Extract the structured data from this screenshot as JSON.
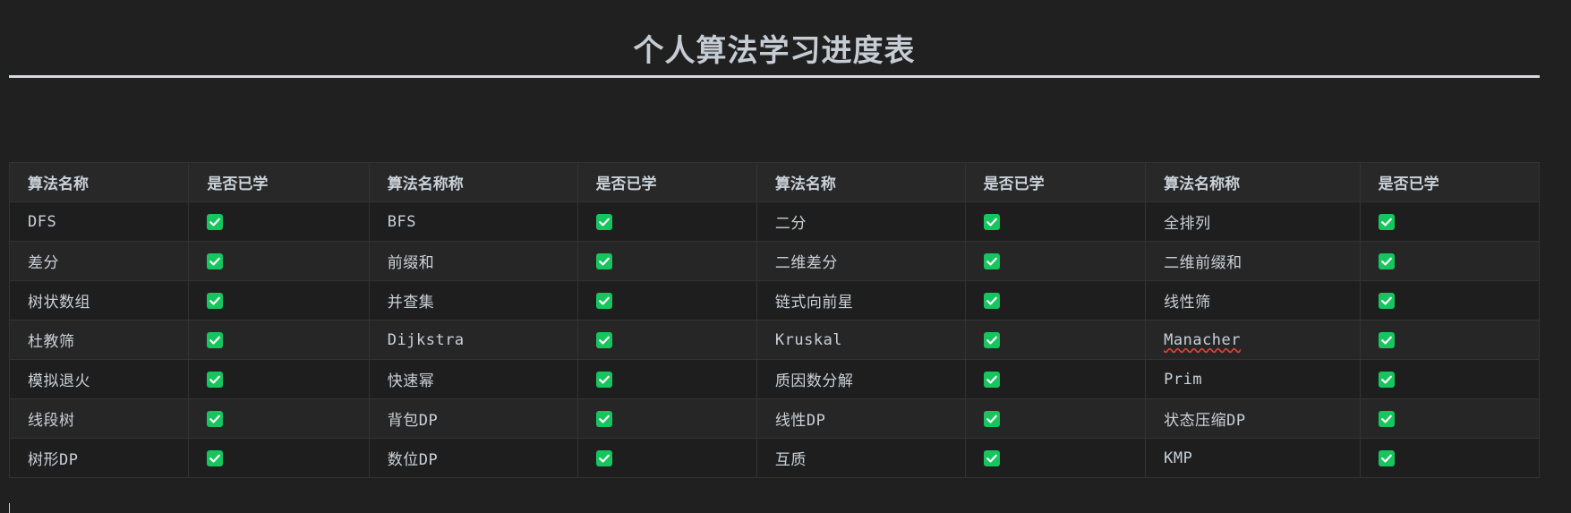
{
  "title": "个人算法学习进度表",
  "accent_colors": {
    "checkbox": "#16c55e",
    "spellcheck_underline": "#e0413a"
  },
  "table": {
    "headers": [
      "算法名称",
      "是否已学",
      "算法名称称",
      "是否已学",
      "算法名称",
      "是否已学",
      "算法名称称",
      "是否已学"
    ],
    "rows": [
      {
        "a1": "DFS",
        "a2": "BFS",
        "a3": "二分",
        "a4": "全排列",
        "checked": [
          true,
          true,
          true,
          true
        ]
      },
      {
        "a1": "差分",
        "a2": "前缀和",
        "a3": "二维差分",
        "a4": "二维前缀和",
        "checked": [
          true,
          true,
          true,
          true
        ]
      },
      {
        "a1": "树状数组",
        "a2": "并查集",
        "a3": "链式向前星",
        "a4": "线性筛",
        "checked": [
          true,
          true,
          true,
          true
        ]
      },
      {
        "a1": "杜教筛",
        "a2": "Dijkstra",
        "a3": "Kruskal",
        "a4": "Manacher",
        "checked": [
          true,
          true,
          true,
          true
        ]
      },
      {
        "a1": "模拟退火",
        "a2": "快速幂",
        "a3": "质因数分解",
        "a4": "Prim",
        "checked": [
          true,
          true,
          true,
          true
        ]
      },
      {
        "a1": "线段树",
        "a2": "背包DP",
        "a3": "线性DP",
        "a4": "状态压缩DP",
        "checked": [
          true,
          true,
          true,
          true
        ]
      },
      {
        "a1": "树形DP",
        "a2": "数位DP",
        "a3": "互质",
        "a4": "KMP",
        "checked": [
          true,
          true,
          true,
          true
        ]
      }
    ]
  },
  "icons": {
    "check": "checkbox-checked-icon"
  }
}
